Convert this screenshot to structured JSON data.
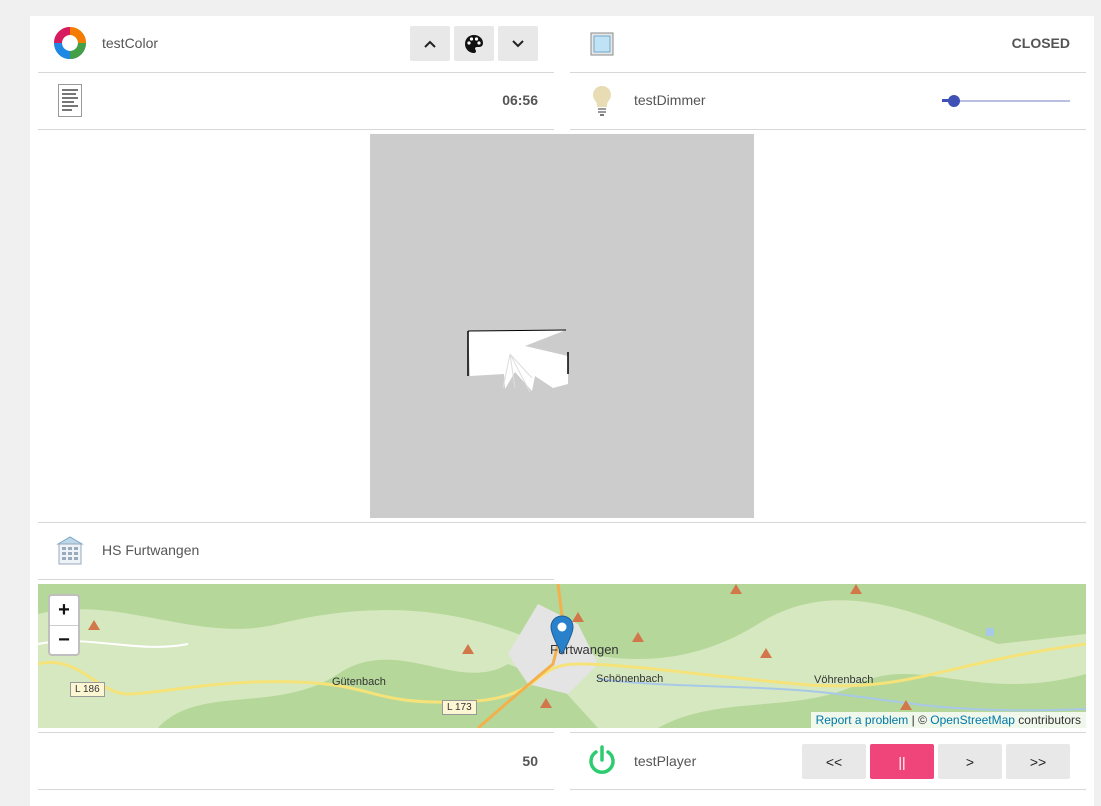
{
  "color_item": {
    "label": "testColor"
  },
  "contact_item": {
    "state": "CLOSED"
  },
  "datetime_item": {
    "value": "06:56"
  },
  "dimmer_item": {
    "label": "testDimmer",
    "level_percent": 9
  },
  "location_item": {
    "label": "HS Furtwangen"
  },
  "map": {
    "zoom_in": "+",
    "zoom_out": "−",
    "places": [
      "Furtwangen",
      "Schönenbach",
      "Gütenbach",
      "Vöhrenbach"
    ],
    "roads": [
      "L 186",
      "L 173"
    ],
    "attribution": {
      "report": "Report a problem",
      "separator": " | © ",
      "osm": "OpenStreetMap",
      "suffix": " contributors"
    }
  },
  "number_item": {
    "value": "50"
  },
  "player_item": {
    "label": "testPlayer",
    "buttons": {
      "previous": "<<",
      "pause": "||",
      "play": ">",
      "next": ">>"
    }
  },
  "colors": {
    "accent_slider": "#3f51b5",
    "pink": "#f0457a",
    "power_green": "#2ecc71"
  }
}
